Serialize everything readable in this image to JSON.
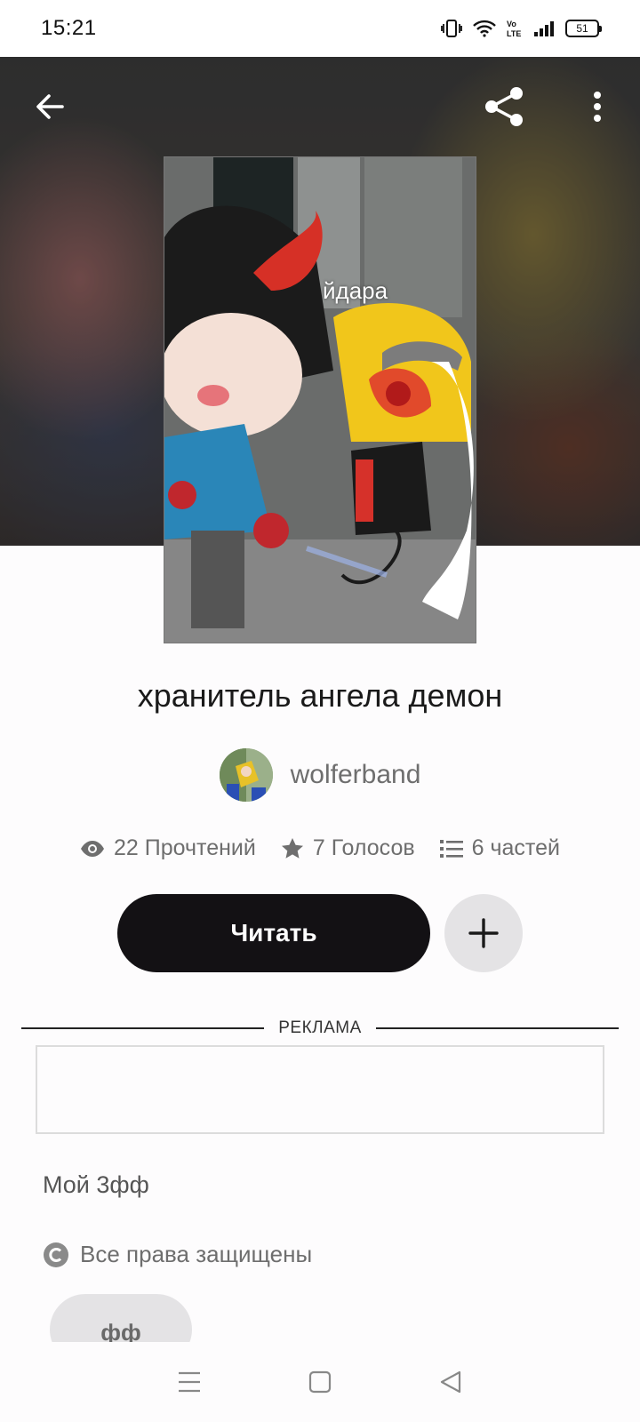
{
  "status_bar": {
    "time": "15:21",
    "battery": "51",
    "icons": [
      "vibrate-icon",
      "wifi-icon",
      "volte-icon",
      "signal-icon",
      "battery-icon"
    ]
  },
  "header": {
    "icons": [
      "back-arrow-icon",
      "share-icon",
      "more-vertical-icon"
    ]
  },
  "cover": {
    "caption": "йдара"
  },
  "story": {
    "title": "хранитель ангела демон",
    "author": "wolferband",
    "stats": {
      "reads": "22 Прочтений",
      "votes": "7 Голосов",
      "parts": "6 частей"
    },
    "read_label": "Читать",
    "description": "Мой 3фф",
    "copyright": "Все права защищены",
    "tag": "фф"
  },
  "ad": {
    "label": "РЕКЛАМА"
  },
  "nav": {
    "icons": [
      "menu-icon",
      "home-square-icon",
      "back-triangle-icon"
    ]
  },
  "colors": {
    "primary_button": "#131114",
    "secondary_button": "#e4e3e5",
    "muted_text": "#6e6e6e"
  }
}
